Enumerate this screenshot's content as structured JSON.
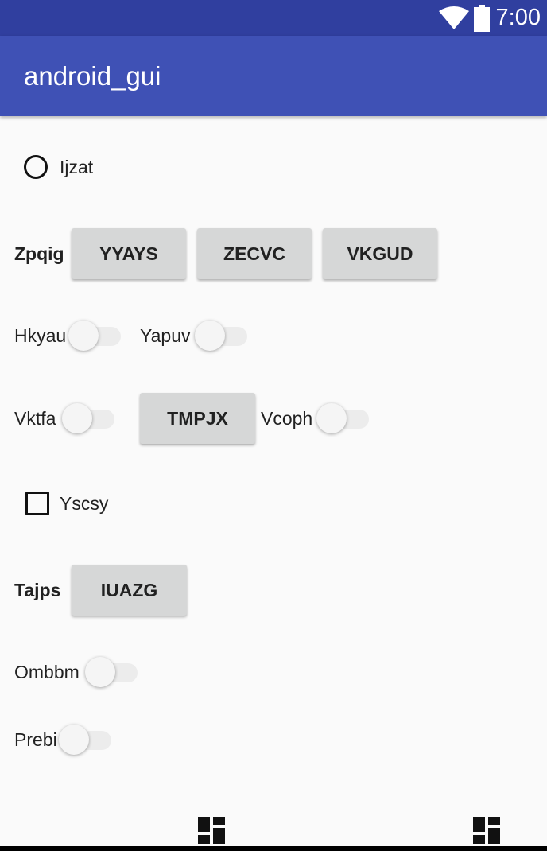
{
  "status_bar": {
    "time": "7:00",
    "icons": [
      "wifi-icon",
      "battery-icon"
    ]
  },
  "app_bar": {
    "title": "android_gui"
  },
  "colors": {
    "status_bar": "#303f9f",
    "app_bar": "#3f51b5",
    "button": "#d6d7d7",
    "background": "#fafafa"
  },
  "content": {
    "radio": {
      "label": "Ijzat",
      "checked": false
    },
    "row_zpqig": {
      "label": "Zpqig",
      "buttons": [
        "YYAYS",
        "ZECVC",
        "VKGUD"
      ]
    },
    "row_switches_1": {
      "switch_a": {
        "label": "Hkyau",
        "on": false
      },
      "switch_b": {
        "label": "Yapuv",
        "on": false
      }
    },
    "row_vktfa": {
      "switch_a": {
        "label": "Vktfa",
        "on": false
      },
      "button": "TMPJX",
      "switch_b": {
        "label": "Vcoph",
        "on": false
      }
    },
    "checkbox": {
      "label": "Yscsy",
      "checked": false
    },
    "row_tajps": {
      "label": "Tajps",
      "button": "IUAZG"
    },
    "switch_ombbm": {
      "label": "Ombbm",
      "on": false
    },
    "switch_prebi": {
      "label": "Prebi",
      "on": false
    }
  },
  "bottom_icons": [
    "dashboard-icon",
    "dashboard-icon"
  ]
}
